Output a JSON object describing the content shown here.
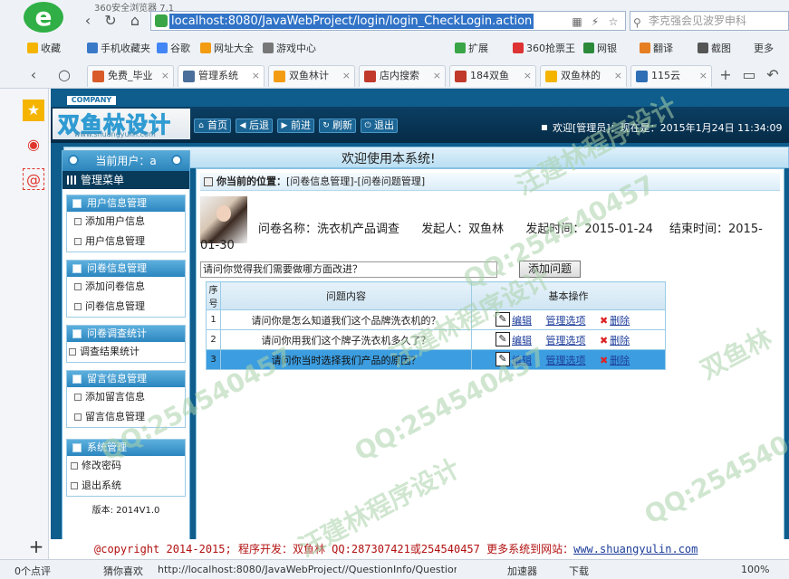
{
  "browser": {
    "window_title": "360安全浏览器 7.1",
    "url": "localhost:8080/JavaWebProject/login/login_CheckLogin.action",
    "url_prefix": "http://",
    "search_placeholder": "李克强会见波罗申科",
    "favorites": [
      "收藏",
      "手机收藏夹",
      "谷歌",
      "网址大全",
      "游戏中心",
      "扩展",
      "360抢票王",
      "网银",
      "翻译",
      "截图",
      "更多"
    ],
    "tabs": [
      {
        "label": "免费_毕业",
        "active": false
      },
      {
        "label": "管理系统",
        "active": true
      },
      {
        "label": "双鱼林计",
        "active": false
      },
      {
        "label": "店内搜索",
        "active": false
      },
      {
        "label": "184双鱼",
        "active": false
      },
      {
        "label": "双鱼林的",
        "active": false
      },
      {
        "label": "115云",
        "active": false
      }
    ],
    "status": {
      "comments": "0个点评",
      "guess": "猜你喜欢",
      "link": "http://localhost:8080/JavaWebProject//QuestionInfo/QuestionI",
      "accelerator": "加速器",
      "download": "下载",
      "zoom": "100%"
    }
  },
  "app": {
    "company_tag": "COMPANY",
    "logo_text": "双鱼林设计",
    "logo_sub": "www.shuangyulin.com",
    "nav": [
      "首页",
      "后退",
      "前进",
      "刷新",
      "退出"
    ],
    "welcome": "欢迎[管理员]：现在是：2015年1月24日 11:34:09",
    "banner_title": "欢迎使用本系统!",
    "sidebar": {
      "current_user": "当前用户：a",
      "menu_title": "管理菜单",
      "groups": [
        {
          "title": "用户信息管理",
          "items": [
            "添加用户信息",
            "用户信息管理"
          ]
        },
        {
          "title": "问卷信息管理",
          "items": [
            "添加问卷信息",
            "问卷信息管理"
          ]
        },
        {
          "title": "问卷调查统计",
          "items": [
            "调查结果统计"
          ]
        },
        {
          "title": "留言信息管理",
          "items": [
            "添加留言信息",
            "留言信息管理"
          ]
        },
        {
          "title": "系统管理",
          "items": [
            "修改密码",
            "退出系统"
          ]
        }
      ],
      "version": "版本: 2014V1.0"
    },
    "main": {
      "position_label": "你当前的位置：",
      "position_path": "[问卷信息管理]-[问卷问题管理]",
      "survey_name": "问卷名称：洗衣机产品调查",
      "initiator": "发起人：双鱼林",
      "start_time": "发起时间：2015-01-24",
      "end_time_a": "结束时间：2015-",
      "end_time_b": "01-30",
      "question_input_value": "请问你觉得我们需要做哪方面改进？",
      "add_button": "添加问题",
      "table": {
        "headers": [
          "序号",
          "问题内容",
          "基本操作"
        ],
        "rows": [
          {
            "num": "1",
            "content": "请问你是怎么知道我们这个品牌洗衣机的？"
          },
          {
            "num": "2",
            "content": "请问你用我们这个牌子洗衣机多久了？"
          },
          {
            "num": "3",
            "content": "请问你当时选择我们产品的原因？"
          }
        ],
        "ops": {
          "edit": "编辑",
          "manage": "管理选项",
          "delete": "删除"
        }
      }
    },
    "footer": {
      "text": "@copyright 2014-2015; 程序开发：双鱼林  QQ:287307421或254540457  更多系统到网站：",
      "link": "www.shuangyulin.com"
    }
  },
  "watermarks": [
    "QQ:254540457",
    "汪建林程序设计",
    "双鱼林"
  ]
}
